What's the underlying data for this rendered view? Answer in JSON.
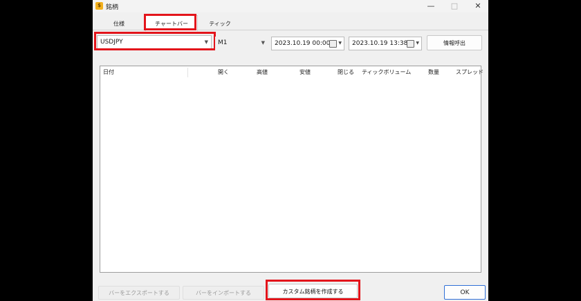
{
  "window": {
    "title": "銘柄",
    "icon_label": "$",
    "minimize": "—",
    "maximize": "□",
    "close": "✕"
  },
  "tabs": [
    {
      "label": "仕様",
      "active": false
    },
    {
      "label": "チャートバー",
      "active": true
    },
    {
      "label": "ティック",
      "active": false
    }
  ],
  "controls": {
    "symbol": "USDJPY",
    "timeframe": "M1",
    "date_from": "2023.10.19 00:00",
    "date_to": "2023.10.19 13:38",
    "info_button": "情報呼出"
  },
  "table": {
    "columns": [
      "日付",
      "開く",
      "高値",
      "安値",
      "閉じる",
      "ティックボリューム",
      "数量",
      "スプレッド"
    ],
    "rows": []
  },
  "footer": {
    "export": "バーをエクスポートする",
    "import": "バーをインポートする",
    "custom": "カスタム銘柄を作成する",
    "ok": "OK"
  },
  "colors": {
    "highlight": "#e3141b",
    "ok_border": "#2f6fd6"
  }
}
